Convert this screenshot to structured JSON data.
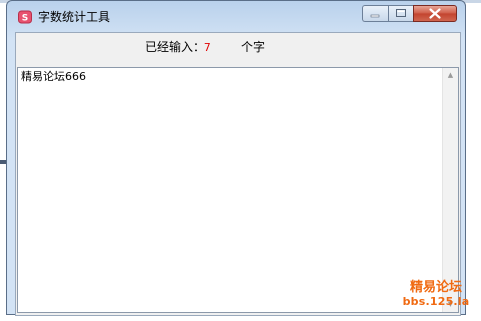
{
  "window": {
    "title": "字数统计工具",
    "icon": "app-icon",
    "controls": [
      "minimize-icon",
      "maximize-icon",
      "close-icon"
    ]
  },
  "counter": {
    "label": "已经输入：",
    "value": "7",
    "unit": "个字",
    "value_color": "#e00000"
  },
  "editor": {
    "text": "精易论坛666"
  },
  "watermark": {
    "line1": "精易论坛",
    "line2": "bbs.125.la",
    "color": "#f06a12"
  }
}
